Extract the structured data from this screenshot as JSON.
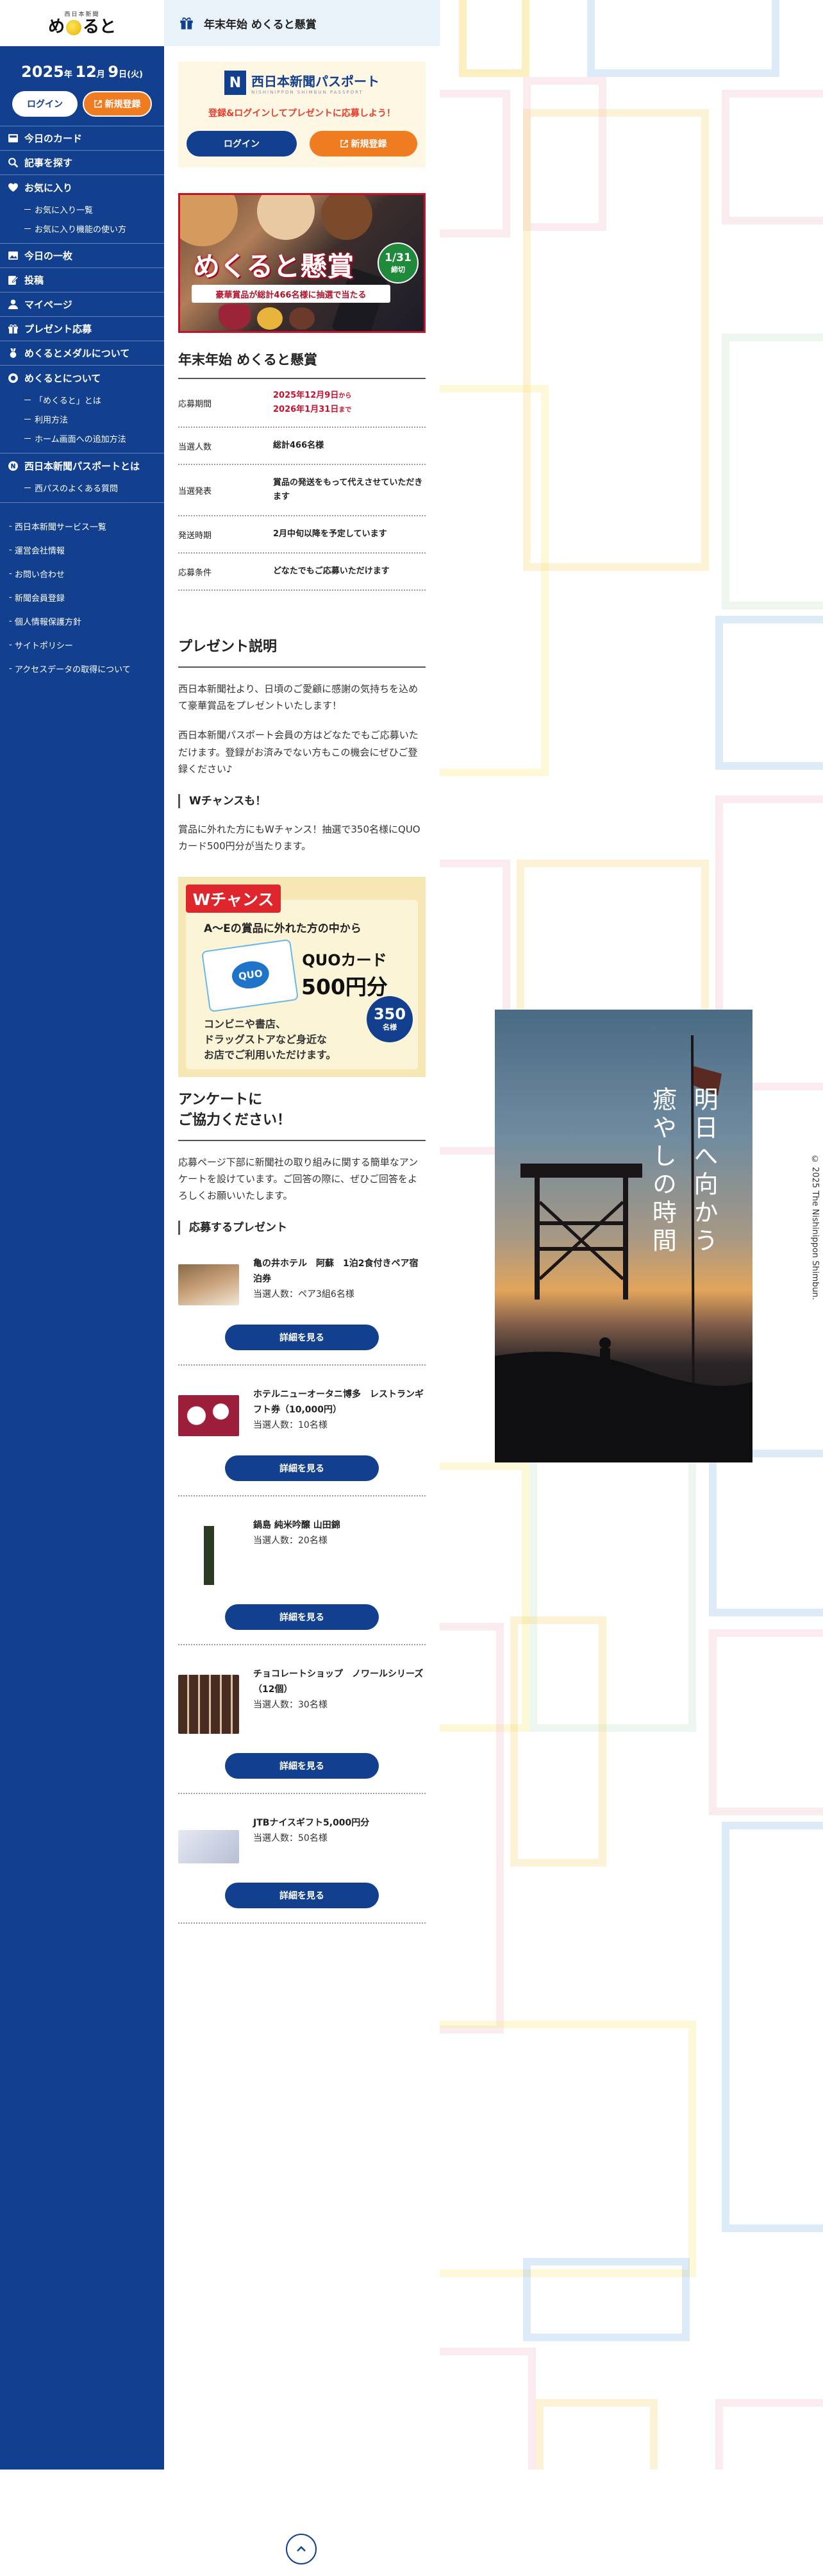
{
  "logo": {
    "small": "西日本新聞",
    "main_left": "め",
    "main_right": "ると"
  },
  "date": {
    "year": "2025",
    "year_unit": "年",
    "month": "12",
    "month_unit": "月",
    "day": "9",
    "day_unit": "日",
    "weekday": "(火)"
  },
  "auth": {
    "login": "ログイン",
    "register": "新規登録"
  },
  "nav": {
    "today_card": "今日のカード",
    "find_article": "記事を探す",
    "favorites": "お気に入り",
    "fav_list": "お気に入り一覧",
    "fav_howto": "お気に入り機能の使い方",
    "today_photo": "今日の一枚",
    "post": "投稿",
    "mypage": "マイページ",
    "present": "プレゼント応募",
    "medal": "めくるとメダルについて",
    "about": "めくるとについて",
    "about_what": "「めくると」とは",
    "about_usage": "利用方法",
    "about_home": "ホーム画面への追加方法",
    "passport": "西日本新聞パスポートとは",
    "passport_faq": "西パスのよくある質問"
  },
  "side_links": [
    "西日本新聞サービス一覧",
    "運営会社情報",
    "お問い合わせ",
    "新聞会員登録",
    "個人情報保護方針",
    "サイトポリシー",
    "アクセスデータの取得について"
  ],
  "topbar": {
    "title": "年末年始 めくると懸賞"
  },
  "passport_box": {
    "logo_letter": "N",
    "logo_text": "西日本新聞パスポート",
    "logo_sub": "NISHINIPPON SHIMBUN PASSPORT",
    "message": "登録&ログインしてプレゼントに応募しよう！"
  },
  "banner": {
    "title": "めくると懸賞",
    "sub": "豪華賞品が総計466名様に抽選で当たる",
    "badge_date": "1/31",
    "badge_label": "締切"
  },
  "detail": {
    "title": "年末年始 めくると懸賞",
    "rows": [
      {
        "key": "応募期間",
        "line1": "2025年12月9日",
        "line1_suffix": "から",
        "line2": "2026年1月31日",
        "line2_suffix": "まで"
      },
      {
        "key": "当選人数",
        "value": "総計466名様"
      },
      {
        "key": "当選発表",
        "value": "賞品の発送をもって代えさせていただきます"
      },
      {
        "key": "発送時期",
        "value": "2月中旬以降を予定しています"
      },
      {
        "key": "応募条件",
        "value": "どなたでもご応募いただけます"
      }
    ]
  },
  "explanation": {
    "title": "プレゼント説明",
    "p1": "西日本新聞社より、日頃のご愛顧に感謝の気持ちを込めて豪華賞品をプレゼントいたします！",
    "p2": "西日本新聞パスポート会員の方はどなたでもご応募いただけます。登録がお済みでない方もこの機会にぜひご登録ください♪",
    "wchance_title": "Wチャンスも！",
    "p3": "賞品に外れた方にもWチャンス！抽選で350名様にQUOカード500円分が当たります。"
  },
  "wchance_img": {
    "tag": "Wチャンス",
    "head": "A～Eの賞品に外れた方の中から",
    "card": "QUO",
    "quo1": "QUOカード",
    "quo2": "500円分",
    "count": "350",
    "count_unit": "名様",
    "text1": "コンビニや書店、",
    "text2": "ドラッグストアなど身近な",
    "text3": "お店でご利用いただけます。"
  },
  "survey": {
    "title_line1": "アンケートに",
    "title_line2": "ご協力ください！",
    "p": "応募ページ下部に新聞社の取り組みに関する簡単なアンケートを設けています。ご回答の際に、ぜひご回答をよろしくお願いいたします。",
    "prizes_title": "応募するプレゼント"
  },
  "prizes": [
    {
      "name": "亀の井ホテル　阿蘇　1泊2食付きペア宿泊券",
      "count": "当選人数：ペア3組6名様",
      "button": "詳細を見る"
    },
    {
      "name": "ホテルニューオータニ博多　レストランギフト券（10,000円）",
      "count": "当選人数：10名様",
      "button": "詳細を見る"
    },
    {
      "name": "鍋島 純米吟醸 山田錦",
      "count": "当選人数：20名様",
      "button": "詳細を見る"
    },
    {
      "name": "チョコレートショップ　ノワールシリーズ（12個）",
      "count": "当選人数：30名様",
      "button": "詳細を見る"
    },
    {
      "name": "JTBナイスギフト5,000円分",
      "count": "当選人数：50名様",
      "button": "詳細を見る"
    }
  ],
  "photo_text": {
    "line1": "明日へ向かう",
    "line2": "癒やしの時間"
  },
  "copyright": "© 2025 The Nishinippon Shimbun.",
  "colors": {
    "brand_blue": "#12408e",
    "accent_orange": "#f07c22",
    "accent_red": "#c8102e"
  }
}
